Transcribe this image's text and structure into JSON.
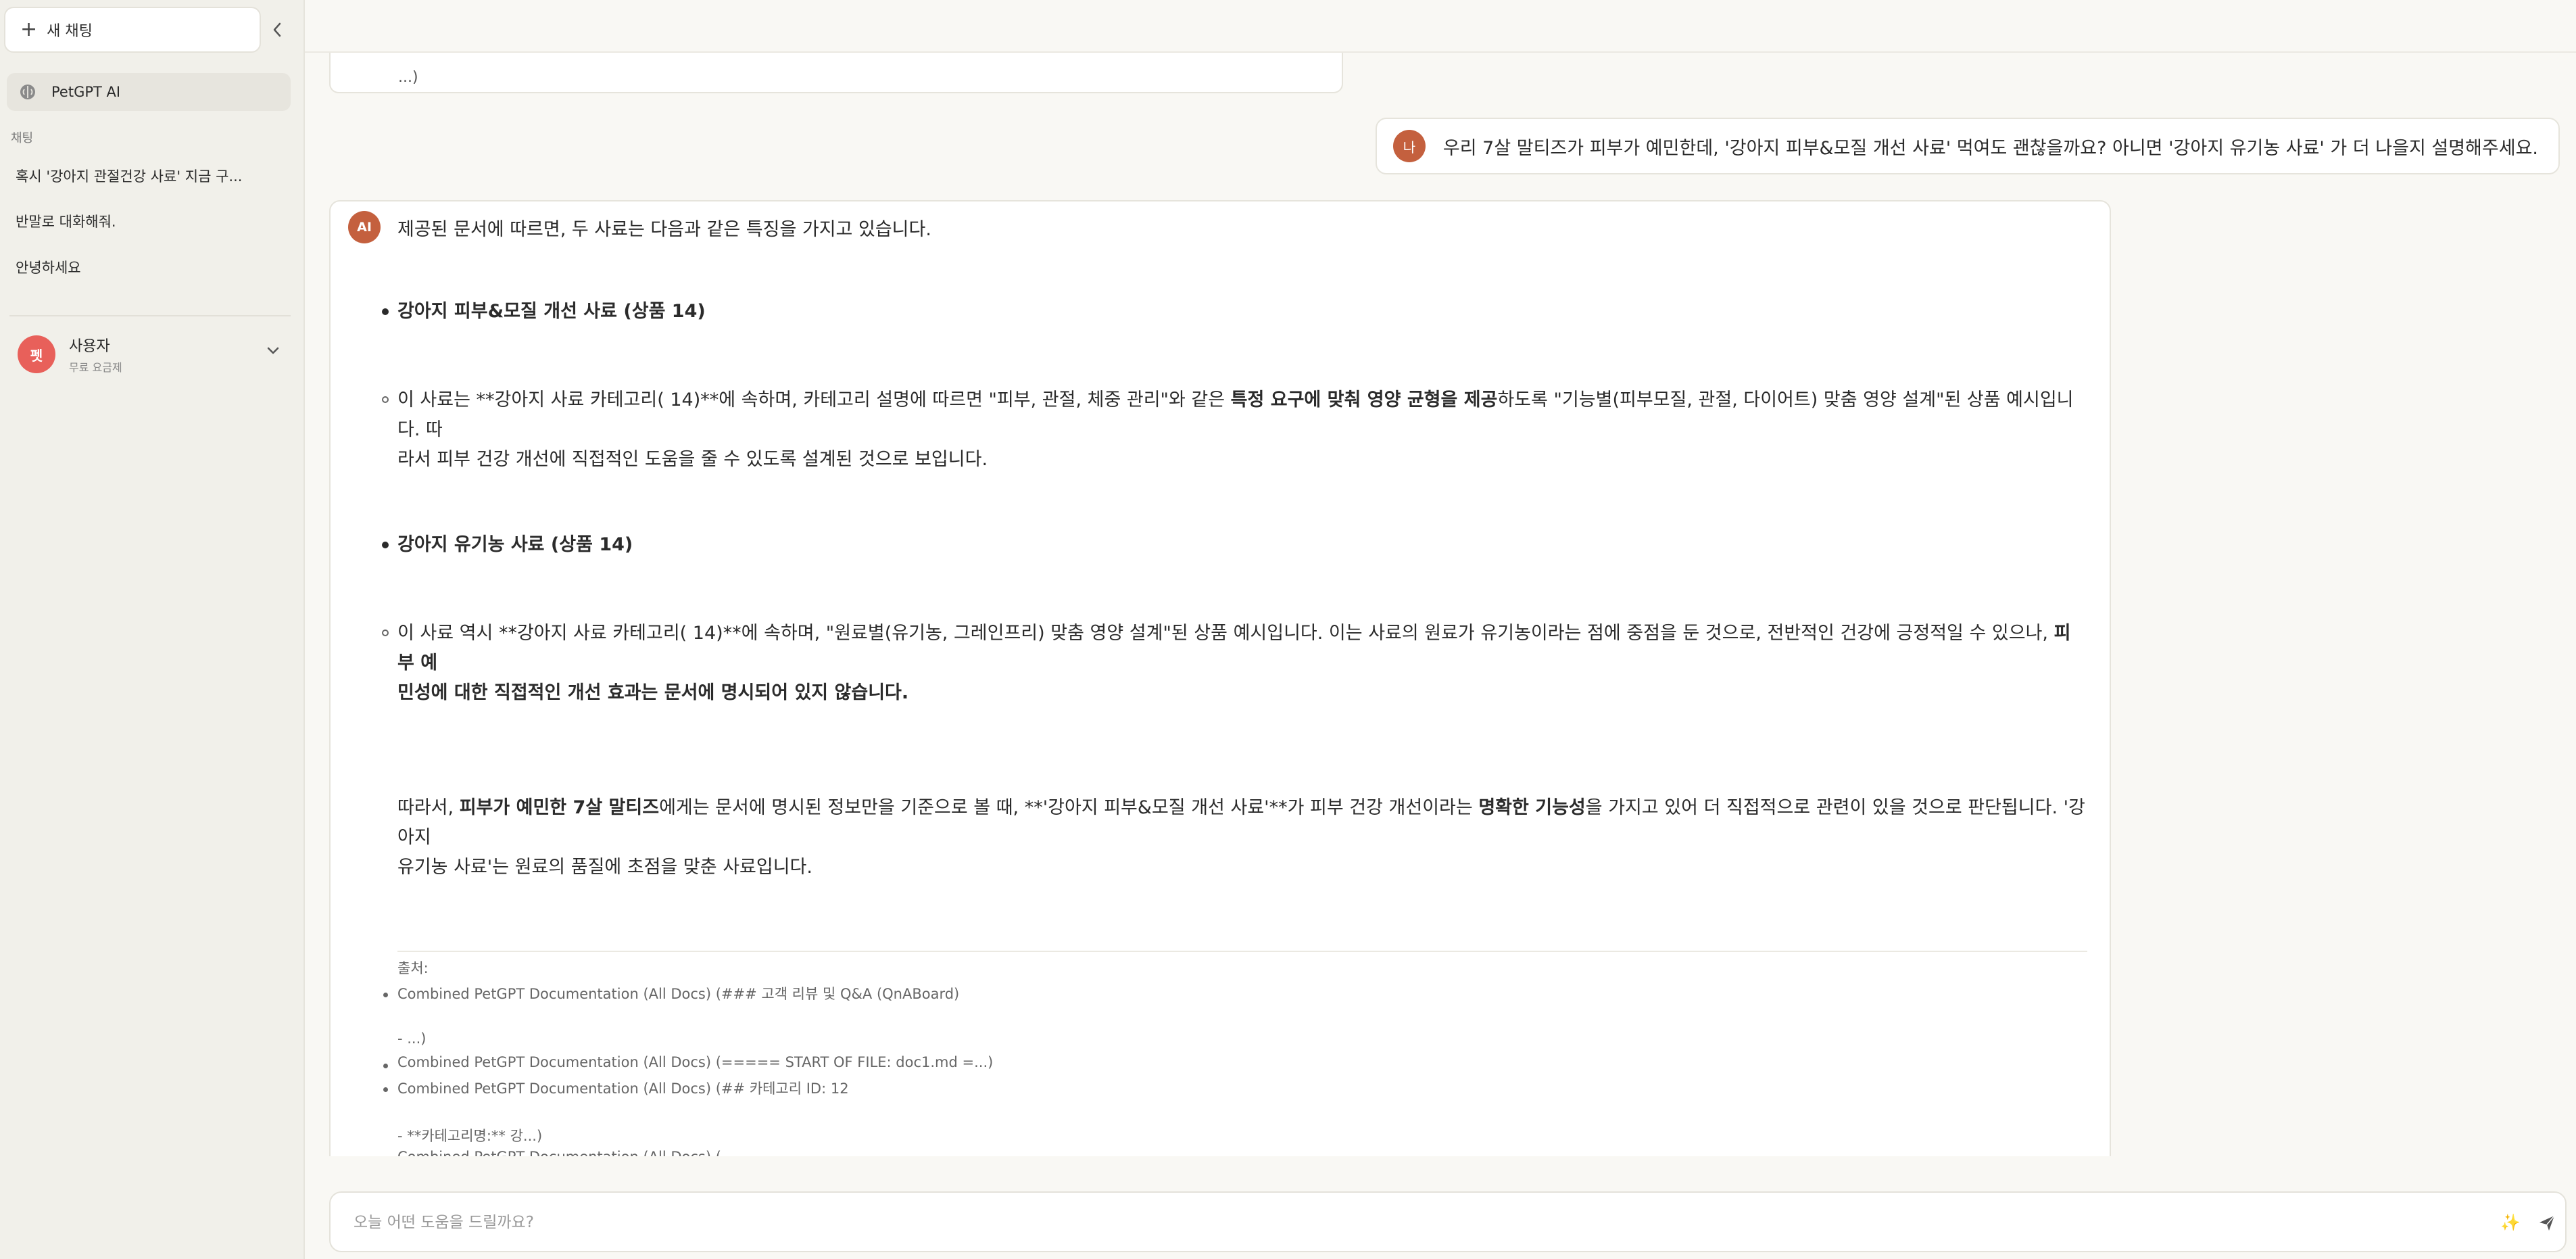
{
  "sidebar": {
    "new_chat_label": "새 채팅",
    "agent_label": "PetGPT AI",
    "section_label": "채팅",
    "chats": [
      "혹시 '강아지 관절건강 사료' 지금 구...",
      "반말로 대화해줘.",
      "안녕하세요"
    ],
    "user": {
      "avatar_text": "펫",
      "name": "사용자",
      "plan": "무료 요금제"
    }
  },
  "conversation": {
    "prev_tail": "...)",
    "user_avatar": "나",
    "user_message": "우리 7살 말티즈가 피부가 예민한데, '강아지 피부&모질 개선 사료' 먹여도 괜찮을까요? 아니면 '강아지 유기농 사료' 가 더 나을지 설명해주세요.",
    "ai_avatar": "AI",
    "ai": {
      "intro": "제공된 문서에 따르면, 두 사료는 다음과 같은 특징을 가지고 있습니다.",
      "item1_title": "강아지 피부&모질 개선 사료 (상품 14)",
      "item1_desc_a": "이 사료는 **강아지 사료 카테고리( 14)**에 속하며, 카테고리 설명에 따르면 \"피부, 관절, 체중 관리\"와 같은 ",
      "item1_desc_bold": "특정 요구에 맞춰 영양 균형을 제공",
      "item1_desc_b": "하도록 \"기능별(피부모질, 관절, 다이어트) 맞춤 영양 설계\"된 상품 예시입니다. 따",
      "item1_desc_line2": "라서 피부 건강 개선에 직접적인 도움을 줄 수 있도록 설계된 것으로 보입니다.",
      "item2_title": "강아지 유기농 사료 (상품 14)",
      "item2_desc_a": "이 사료 역시 **강아지 사료 카테고리( 14)**에 속하며, \"원료별(유기농, 그레인프리) 맞춤 영양 설계\"된 상품 예시입니다. 이는 사료의 원료가 유기농이라는 점에 중점을 둔 것으로, 전반적인 건강에 긍정적일 수 있으나, ",
      "item2_desc_bold1": "피부 예",
      "item2_desc_bold2": "민성에 대한 직접적인 개선 효과는 문서에 명시되어 있지 않습니다.",
      "concl_a": "따라서, ",
      "concl_bold1": "피부가 예민한 7살 말티즈",
      "concl_b": "에게는 문서에 명시된 정보만을 기준으로 볼 때, **'강아지 피부&모질 개선 사료'**가 피부 건강 개선이라는 ",
      "concl_bold2": "명확한 기능성",
      "concl_c": "을 가지고 있어 더 직접적으로 관련이 있을 것으로 판단됩니다. '강아지",
      "concl_line2": "유기농 사료'는 원료의 품질에 초점을 맞춘 사료입니다."
    },
    "sources": {
      "label": "출처:",
      "s1": "Combined PetGPT Documentation (All Docs) (### 고객 리뷰 및 Q&A (QnABoard)",
      "s1_cont": "- ...)",
      "s2": "Combined PetGPT Documentation (All Docs) (===== START OF FILE: doc1.md =...)",
      "s3": "Combined PetGPT Documentation (All Docs) (## 카테고리 ID: 12",
      "s3_cont": "- **카테고리명:** 강...)",
      "s4": "Combined PetGPT Documentation (All Docs) (---"
    }
  },
  "composer": {
    "placeholder": "오늘 어떤 도움을 드릴까요?",
    "value": ""
  }
}
